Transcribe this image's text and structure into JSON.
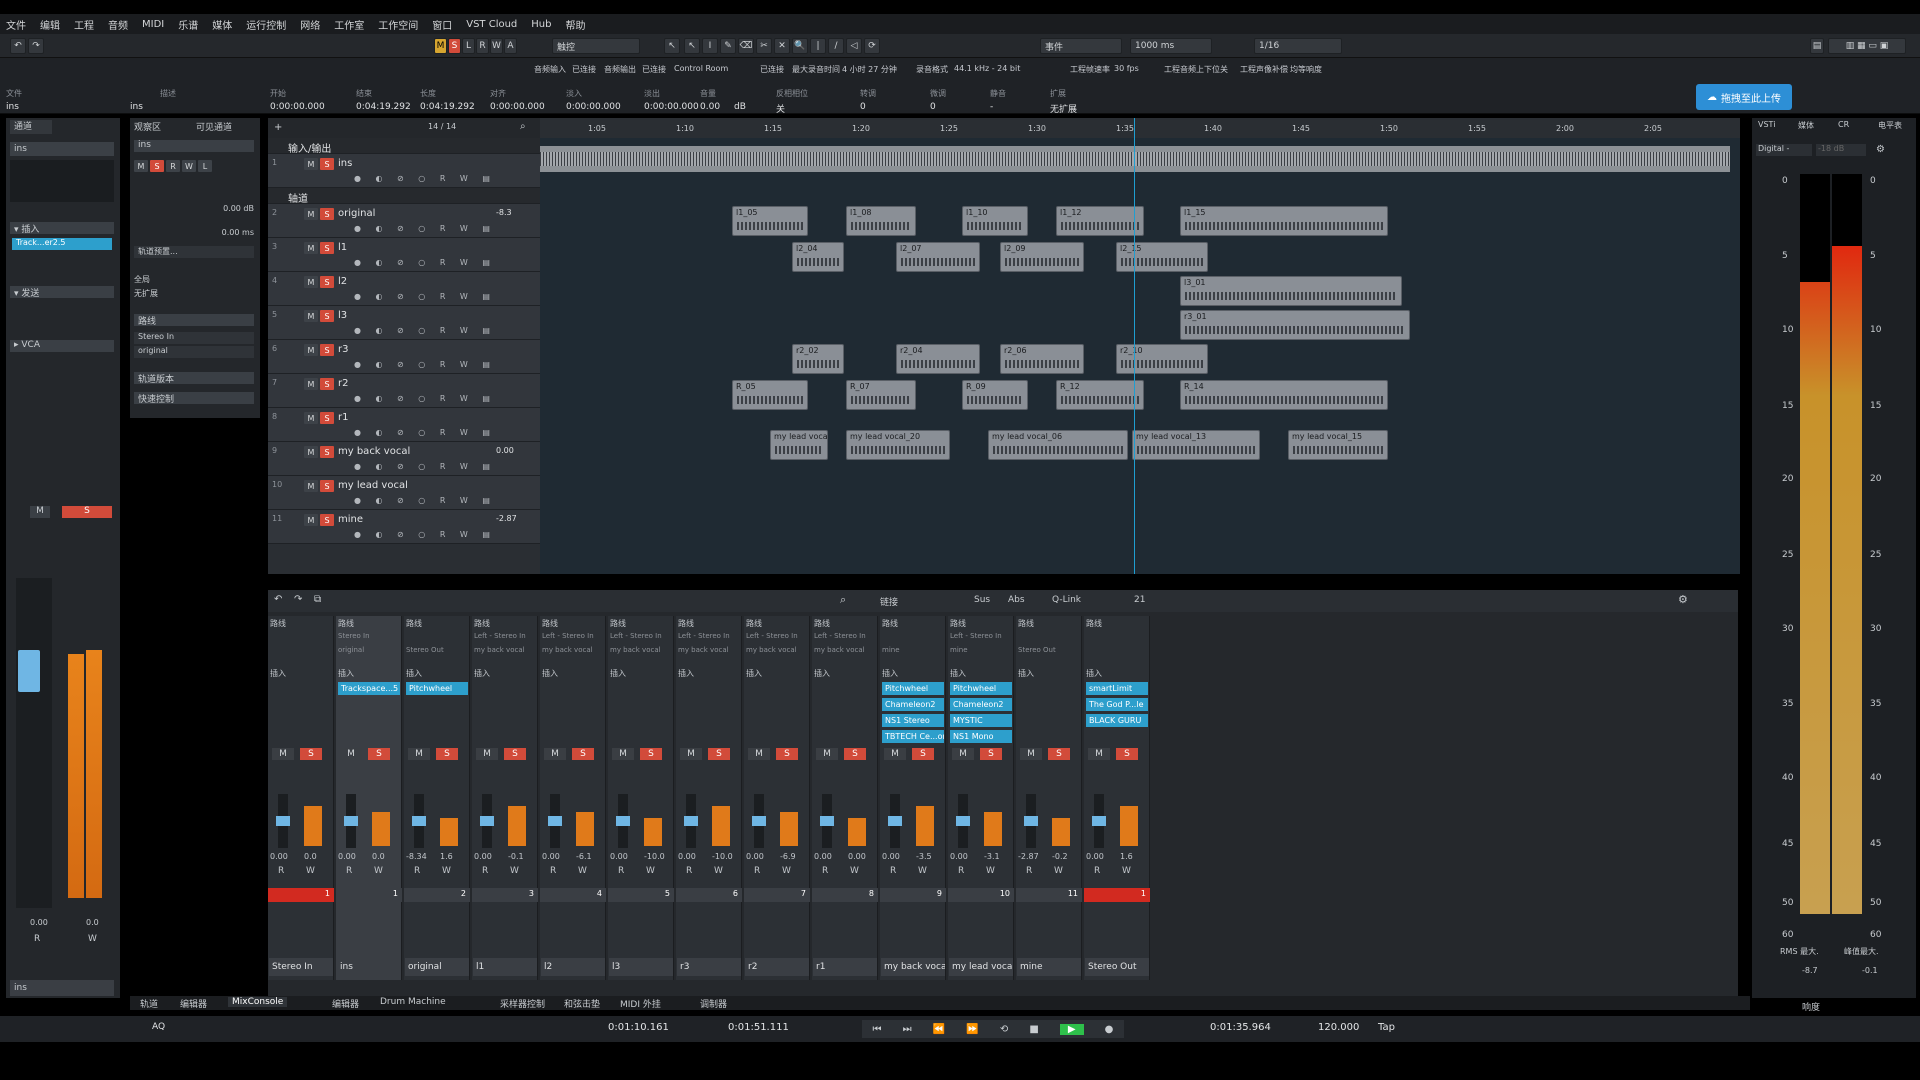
{
  "menu": [
    "文件",
    "编辑",
    "工程",
    "音频",
    "MIDI",
    "乐谱",
    "媒体",
    "运行控制",
    "网络",
    "工作室",
    "工作空间",
    "窗口",
    "VST Cloud",
    "Hub",
    "帮助"
  ],
  "toolbar": {
    "mode_buttons": [
      "M",
      "S",
      "L",
      "R",
      "W",
      "A"
    ],
    "touch_mode": "触控",
    "event_label": "事件",
    "event_value": "1000 ms",
    "grid_value": "1/16",
    "tools": [
      "↖",
      "I",
      "✎",
      "⌫",
      "✂",
      "✕",
      "🔍",
      "|",
      "/",
      "◁",
      "⟳"
    ]
  },
  "info": {
    "headers": [
      "文件",
      "描述",
      "开始",
      "结束",
      "长度",
      "对齐",
      "淡入",
      "淡出",
      "音量",
      "反相相位",
      "转调",
      "微调",
      "静音",
      "扩展"
    ],
    "values": [
      "ins",
      "ins",
      "0:00:00.000",
      "0:04:19.292",
      "0:04:19.292",
      "0:00:00.000",
      "0:00:00.000",
      "0:00:00.000",
      "0.00",
      "dB",
      "关",
      "0",
      "0",
      "-",
      "无扩展"
    ],
    "top_headers": [
      "音频输入",
      "已连接",
      "音频输出",
      "已连接",
      "Control Room",
      "已连接",
      "最大录音时间",
      "4 小时 27 分钟",
      "录音格式",
      "44.1 kHz - 24 bit",
      "工程帧速率",
      "30 fps",
      "工程音频上下位",
      "关",
      "工程声像补偿",
      "均等响度"
    ]
  },
  "upload_btn": "拖拽至此上传",
  "inspector": {
    "track": "ins",
    "sec_insert": "插入",
    "insert_plugin": "Track...er2.5",
    "sec_send": "发送",
    "sec_vca": "VCA",
    "val1": "0.00",
    "val2": "0.0",
    "r": "R",
    "w": "W",
    "m": "M",
    "s": "S",
    "name": "ins"
  },
  "visibility": {
    "tab1": "观察区",
    "tab2": "可见通道",
    "track": "ins",
    "vol": "0.00 dB",
    "delay": "0.00 ms",
    "preset": "轨道预置...",
    "all": "全局",
    "expand": "无扩展",
    "route": "路线",
    "in": "Stereo In",
    "out": "original",
    "ver": "轨道版本",
    "quick": "快速控制"
  },
  "arr": {
    "count": "14 / 14",
    "ruler": [
      "1:05",
      "1:10",
      "1:15",
      "1:20",
      "1:25",
      "1:30",
      "1:35",
      "1:40",
      "1:45",
      "1:50",
      "1:55",
      "2:00",
      "2:05"
    ]
  },
  "tracks": [
    {
      "num": "",
      "name": "输入/输出",
      "type": "folder"
    },
    {
      "num": "1",
      "name": "ins",
      "type": "audio"
    },
    {
      "num": "",
      "name": "轴道",
      "type": "folder"
    },
    {
      "num": "2",
      "name": "original",
      "type": "audio",
      "val": "-8.3"
    },
    {
      "num": "3",
      "name": "l1",
      "type": "audio"
    },
    {
      "num": "4",
      "name": "l2",
      "type": "audio"
    },
    {
      "num": "5",
      "name": "l3",
      "type": "audio"
    },
    {
      "num": "6",
      "name": "r3",
      "type": "audio"
    },
    {
      "num": "7",
      "name": "r2",
      "type": "audio"
    },
    {
      "num": "8",
      "name": "r1",
      "type": "audio"
    },
    {
      "num": "9",
      "name": "my back vocal",
      "type": "group",
      "val": "0.00"
    },
    {
      "num": "10",
      "name": "my lead vocal",
      "type": "audio"
    },
    {
      "num": "11",
      "name": "mine",
      "type": "group",
      "val": "-2.87"
    }
  ],
  "clips": {
    "l1": [
      "l1_05",
      "l1_08",
      "l1_10",
      "l1_12",
      "l1_15"
    ],
    "l2": [
      "l2_04",
      "l2_07",
      "l2_09",
      "l2_15"
    ],
    "l3": [
      "l3_01"
    ],
    "r3": [
      "r3_01"
    ],
    "r2": [
      "r2_02",
      "r2_04",
      "r2_06",
      "r2_10"
    ],
    "r1": [
      "R_05",
      "R_07",
      "R_09",
      "R_12",
      "R_14"
    ],
    "lead": [
      "my lead vocal_",
      "my lead vocal_20",
      "my lead vocal_06",
      "my lead vocal_13",
      "my lead vocal_15"
    ]
  },
  "mixer": {
    "toolbar": [
      "链接",
      "Sus",
      "Abs",
      "Q-Link",
      "21"
    ],
    "route": "路线",
    "insert": "插入",
    "channels": [
      {
        "name": "Stereo In",
        "in": "",
        "out": "",
        "vol": "0.00",
        "pan": "0.0",
        "num": "1",
        "red": true,
        "plugins": []
      },
      {
        "name": "ins",
        "in": "Stereo In",
        "out": "original",
        "vol": "0.00",
        "pan": "0.0",
        "num": "1",
        "plugins": [
          "Trackspace...5"
        ]
      },
      {
        "name": "original",
        "in": "",
        "out": "Stereo Out",
        "vol": "-8.34",
        "pan": "1.6",
        "num": "2",
        "plugins": [
          "Pitchwheel"
        ]
      },
      {
        "name": "l1",
        "in": "Left - Stereo In",
        "out": "my back vocal",
        "vol": "0.00",
        "pan": "-0.1",
        "num": "3",
        "plugins": []
      },
      {
        "name": "l2",
        "in": "Left - Stereo In",
        "out": "my back vocal",
        "vol": "0.00",
        "pan": "-6.1",
        "num": "4",
        "plugins": []
      },
      {
        "name": "l3",
        "in": "Left - Stereo In",
        "out": "my back vocal",
        "vol": "0.00",
        "pan": "-10.0",
        "num": "5",
        "plugins": []
      },
      {
        "name": "r3",
        "in": "Left - Stereo In",
        "out": "my back vocal",
        "vol": "0.00",
        "pan": "-10.0",
        "num": "6",
        "plugins": []
      },
      {
        "name": "r2",
        "in": "Left - Stereo In",
        "out": "my back vocal",
        "vol": "0.00",
        "pan": "-6.9",
        "num": "7",
        "plugins": []
      },
      {
        "name": "r1",
        "in": "Left - Stereo In",
        "out": "my back vocal",
        "vol": "0.00",
        "pan": "0.00",
        "num": "8",
        "plugins": []
      },
      {
        "name": "my back vocal",
        "in": "",
        "out": "mine",
        "vol": "0.00",
        "pan": "-3.5",
        "num": "9",
        "plugins": [
          "Pitchwheel",
          "Chameleon2",
          "NS1 Stereo",
          "TBTECH Ce...or"
        ]
      },
      {
        "name": "my lead vocal",
        "in": "Left - Stereo In",
        "out": "mine",
        "vol": "0.00",
        "pan": "-3.1",
        "num": "10",
        "plugins": [
          "Pitchwheel",
          "Chameleon2",
          "MYSTIC",
          "NS1 Mono"
        ]
      },
      {
        "name": "mine",
        "in": "",
        "out": "Stereo Out",
        "vol": "-2.87",
        "pan": "-0.2",
        "num": "11",
        "plugins": []
      },
      {
        "name": "Stereo Out",
        "in": "",
        "out": "",
        "vol": "0.00",
        "pan": "1.6",
        "num": "1",
        "red": true,
        "plugins": [
          "smartLimit",
          "The God P...le",
          "BLACK GURU"
        ]
      }
    ]
  },
  "rz": {
    "tabs": [
      "VSTi",
      "媒体",
      "CR",
      "电平表"
    ],
    "preset": "Digital -",
    "preset2": "-18 dB",
    "scale": [
      "0",
      "5",
      "10",
      "15",
      "20",
      "25",
      "30",
      "35",
      "40",
      "45",
      "50",
      "60"
    ],
    "rms_label": "RMS 最大.",
    "peak_label": "峰值最大.",
    "rms": "-8.7",
    "peak": "-0.1",
    "tab_bottom": "响度"
  },
  "bottom_tabs": [
    "轨道",
    "编辑器",
    "MixConsole",
    "编辑器",
    "Drum Machine",
    "采样器控制",
    "和弦击垫",
    "MIDI 外挂",
    "调制器"
  ],
  "transport": {
    "left": "0:01:10.161",
    "right": "0:01:51.111",
    "pos": "0:01:35.964",
    "tempo": "120.000",
    "tap": "Tap",
    "aq": "AQ"
  },
  "colors": {
    "solo_red": "#d24b3a",
    "accent_blue": "#2d9fcc",
    "meter_red": "#e02a10",
    "play_green": "#2ec04b"
  }
}
